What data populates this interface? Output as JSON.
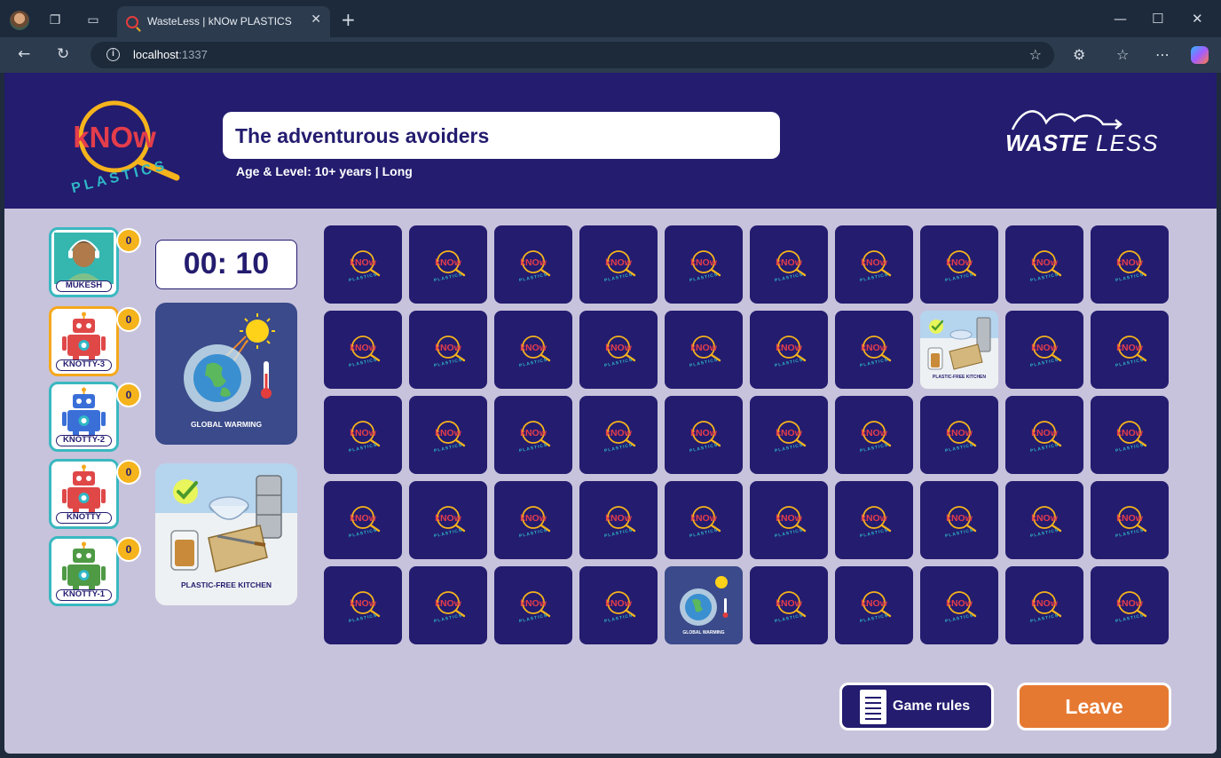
{
  "browser": {
    "tab_title": "WasteLess | kNOw PLASTICS",
    "tab_close": "✕",
    "new_tab": "+",
    "url_host": "localhost",
    "url_port": ":1337",
    "window_controls": [
      "—",
      "☐",
      "✕"
    ]
  },
  "header": {
    "know_logo_main": "kNOw",
    "know_logo_sub": "PLASTICS",
    "team_name": "The adventurous avoiders",
    "age_level": "Age & Level: 10+ years | Long",
    "brand_main": "WASTE",
    "brand_sub": "LESS"
  },
  "players": [
    {
      "name": "MUKESH",
      "score": "0",
      "type": "human",
      "active": false
    },
    {
      "name": "KNOTTY-3",
      "score": "0",
      "type": "robot",
      "color": "#e04848",
      "active": true
    },
    {
      "name": "KNOTTY-2",
      "score": "0",
      "type": "robot",
      "color": "#3a6fd8",
      "active": false
    },
    {
      "name": "KNOTTY",
      "score": "0",
      "type": "robot",
      "color": "#e04848",
      "active": false
    },
    {
      "name": "KNOTTY-1",
      "score": "0",
      "type": "robot",
      "color": "#4f9a45",
      "active": false
    }
  ],
  "timer": "00: 10",
  "revealed": {
    "card1_label": "GLOBAL WARMING",
    "card2_label": "PLASTIC-FREE KITCHEN"
  },
  "grid": {
    "rows": 5,
    "cols": 10,
    "face_up": [
      {
        "row": 1,
        "col": 7,
        "label": "PLASTIC-FREE KITCHEN"
      },
      {
        "row": 4,
        "col": 4,
        "label": "GLOBAL WARMING"
      }
    ]
  },
  "buttons": {
    "game_rules": "Game rules",
    "leave": "Leave"
  },
  "colors": {
    "navy": "#231c6f",
    "background": "#c8c3dc",
    "accent_orange": "#e67931",
    "score_yellow": "#f5b31c",
    "teal": "#3ab8c0"
  }
}
